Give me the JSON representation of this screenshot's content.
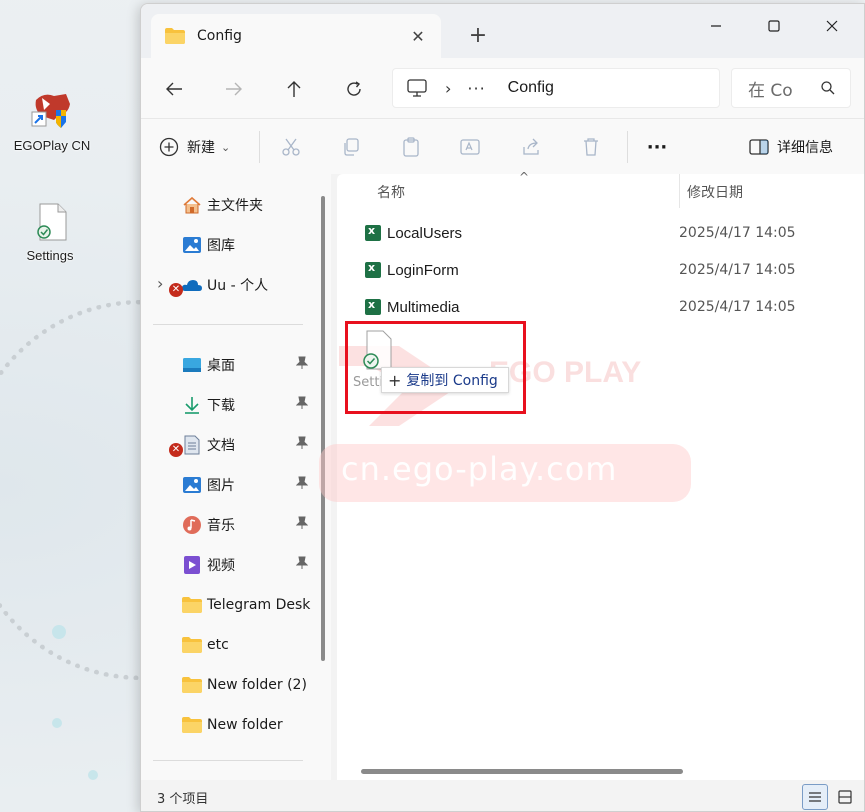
{
  "desktop": {
    "icons": [
      {
        "label": "EGOPlay CN",
        "icon": "egoplay-app-icon"
      },
      {
        "label": "Settings",
        "icon": "settings-file-icon"
      }
    ]
  },
  "window": {
    "tab": {
      "title": "Config",
      "close_symbol": "✕"
    },
    "new_tab_symbol": "+",
    "controls": {
      "minimize": "—",
      "maximize": "☐",
      "close": "✕"
    }
  },
  "address": {
    "separator": "›",
    "overflow": "···",
    "crumb": "Config"
  },
  "search": {
    "placeholder": "在 Co"
  },
  "toolbar": {
    "new_label": "新建",
    "new_dropdown": "⌄",
    "more": "···",
    "details_label": "详细信息"
  },
  "sidebar": {
    "top_items": [
      {
        "label": "主文件夹",
        "icon": "home-icon"
      },
      {
        "label": "图库",
        "icon": "gallery-icon"
      },
      {
        "label": "Uu - 个人",
        "icon": "onedrive-icon"
      }
    ],
    "expand_symbol": "›",
    "pinned_items": [
      {
        "label": "桌面",
        "icon": "desktop-icon",
        "pinned": true
      },
      {
        "label": "下载",
        "icon": "download-icon",
        "pinned": true
      },
      {
        "label": "文档",
        "icon": "documents-icon",
        "pinned": true
      },
      {
        "label": "图片",
        "icon": "pictures-icon",
        "pinned": true
      },
      {
        "label": "音乐",
        "icon": "music-icon",
        "pinned": true
      },
      {
        "label": "视频",
        "icon": "videos-icon",
        "pinned": true
      },
      {
        "label": "Telegram Desk",
        "icon": "folder-icon",
        "pinned": false
      },
      {
        "label": "etc",
        "icon": "folder-icon",
        "pinned": false
      },
      {
        "label": "New folder (2)",
        "icon": "folder-icon",
        "pinned": false
      },
      {
        "label": "New folder",
        "icon": "folder-icon",
        "pinned": false
      }
    ],
    "error_badge": "✕"
  },
  "columns": {
    "name": "名称",
    "modified": "修改日期",
    "sort_arrow": "^"
  },
  "files": [
    {
      "name": "LocalUsers",
      "modified": "2025/4/17 14:05",
      "icon": "excel-icon"
    },
    {
      "name": "LoginForm",
      "modified": "2025/4/17 14:05",
      "icon": "excel-icon"
    },
    {
      "name": "Multimedia",
      "modified": "2025/4/17 14:05",
      "icon": "excel-icon"
    }
  ],
  "drag": {
    "ghost_label": "Setti",
    "tip_plus": "+",
    "tip_text": "复制到 Config"
  },
  "watermark": {
    "logo_text": "EGO PLAY",
    "url": "cn.ego-play.com"
  },
  "status": {
    "item_count": "3 个项目"
  },
  "colors": {
    "highlight": "#e8101e",
    "excel": "#1e7145",
    "accent": "#0067c0"
  }
}
